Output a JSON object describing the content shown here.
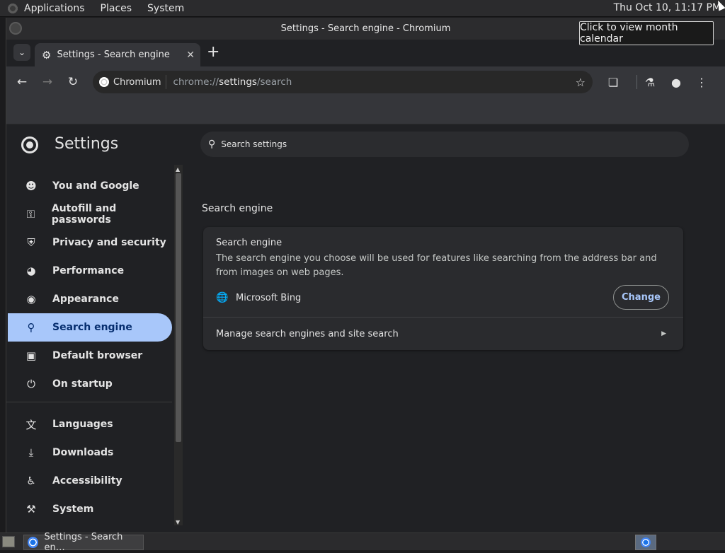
{
  "top_panel": {
    "menus": [
      "Applications",
      "Places",
      "System"
    ],
    "clock": "Thu Oct 10, 11:17 PM"
  },
  "tooltip": "Click to view month calendar",
  "window": {
    "title": "Settings - Search engine - Chromium"
  },
  "tabs": [
    {
      "label": "Settings - Search engine"
    }
  ],
  "toolbar": {
    "omnibox_chip": "Chromium",
    "url_scheme": "chrome://",
    "url_host": "settings",
    "url_path": "/search"
  },
  "settings": {
    "title": "Settings",
    "search_placeholder": "Search settings",
    "sidebar": [
      {
        "label": "You and Google",
        "icon": "person-icon"
      },
      {
        "label": "Autofill and passwords",
        "icon": "key-icon"
      },
      {
        "label": "Privacy and security",
        "icon": "shield-icon"
      },
      {
        "label": "Performance",
        "icon": "speedometer-icon"
      },
      {
        "label": "Appearance",
        "icon": "palette-icon"
      },
      {
        "label": "Search engine",
        "icon": "search-icon",
        "active": true
      },
      {
        "label": "Default browser",
        "icon": "browser-icon"
      },
      {
        "label": "On startup",
        "icon": "power-icon"
      },
      {
        "label": "Languages",
        "icon": "translate-icon"
      },
      {
        "label": "Downloads",
        "icon": "download-icon"
      },
      {
        "label": "Accessibility",
        "icon": "accessibility-icon"
      },
      {
        "label": "System",
        "icon": "wrench-icon"
      }
    ],
    "section_title": "Search engine",
    "card": {
      "heading": "Search engine",
      "description": "The search engine you choose will be used for features like searching from the address bar and from images on web pages.",
      "current_engine": "Microsoft Bing",
      "change_label": "Change",
      "manage_label": "Manage search engines and site search"
    }
  },
  "taskbar": {
    "task_label": "Settings - Search en…"
  },
  "colors": {
    "active_nav_bg": "#a8c7fa",
    "accent_text": "#a8c7fa",
    "page_bg": "#202124",
    "card_bg": "#2a2b2e"
  }
}
